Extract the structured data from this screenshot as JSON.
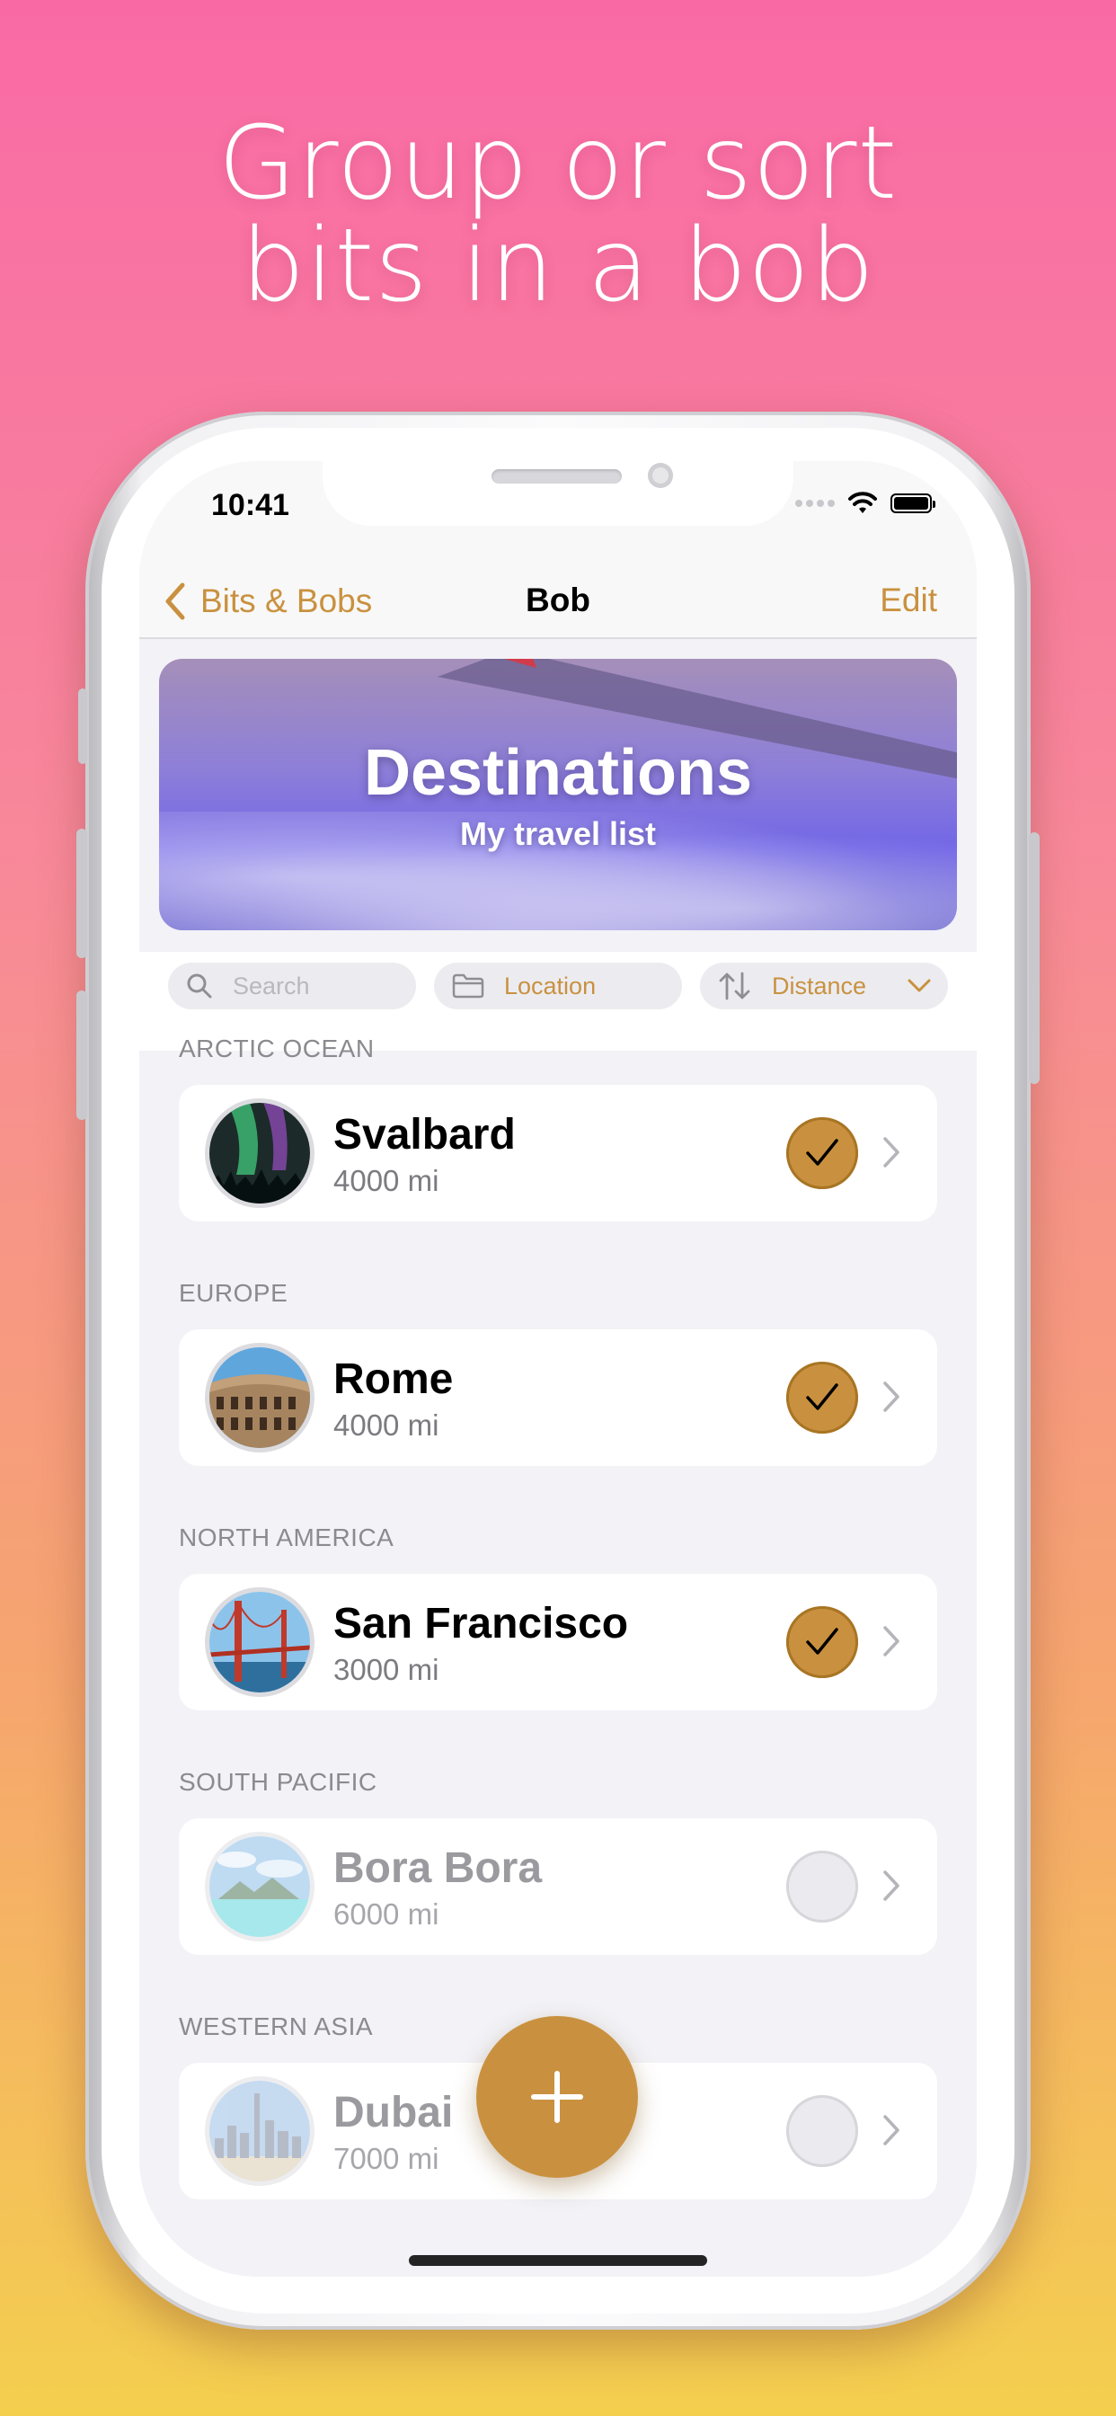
{
  "headline": {
    "line1": "Group or sort",
    "line2": "bits in a bob"
  },
  "status_bar": {
    "time": "10:41"
  },
  "nav": {
    "back_label": "Bits & Bobs",
    "title": "Bob",
    "edit_label": "Edit"
  },
  "banner": {
    "title": "Destinations",
    "subtitle": "My travel list"
  },
  "controls": {
    "search_placeholder": "Search",
    "group_label": "Location",
    "sort_label": "Distance"
  },
  "colors": {
    "accent": "#c9913f",
    "background_top": "#f96aa5",
    "background_bottom": "#f4cf4e"
  },
  "sections": [
    {
      "header": "ARCTIC OCEAN",
      "item": {
        "name": "Svalbard",
        "distance": "4000 mi",
        "checked": true,
        "thumb": "aurora"
      }
    },
    {
      "header": "EUROPE",
      "item": {
        "name": "Rome",
        "distance": "4000 mi",
        "checked": true,
        "thumb": "colosseum"
      }
    },
    {
      "header": "NORTH AMERICA",
      "item": {
        "name": "San Francisco",
        "distance": "3000 mi",
        "checked": true,
        "thumb": "golden-gate"
      }
    },
    {
      "header": "SOUTH PACIFIC",
      "item": {
        "name": "Bora Bora",
        "distance": "6000 mi",
        "checked": false,
        "thumb": "lagoon"
      }
    },
    {
      "header": "WESTERN ASIA",
      "item": {
        "name": "Dubai",
        "distance": "7000 mi",
        "checked": false,
        "thumb": "skyline"
      }
    }
  ]
}
